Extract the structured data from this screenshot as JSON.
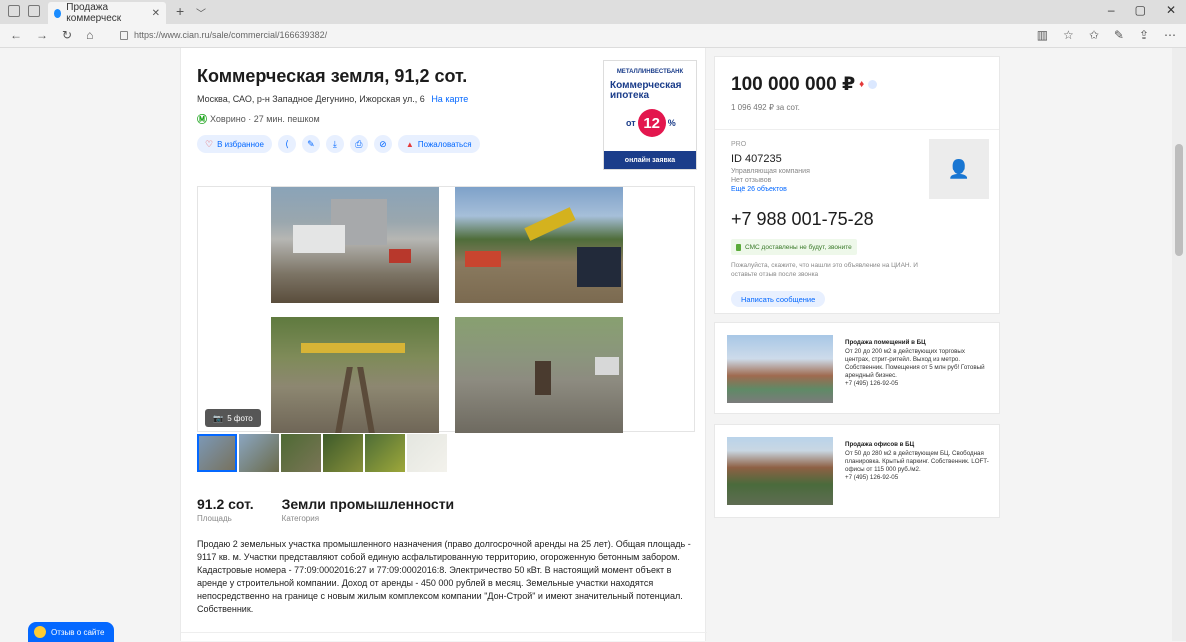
{
  "browser": {
    "tab_title": "Продажа коммерческ",
    "url": "https://www.cian.ru/sale/commercial/166639382/",
    "window_buttons": [
      "–",
      "▢",
      "✕"
    ]
  },
  "listing": {
    "title": "Коммерческая земля, 91,2 сот.",
    "address": "Москва, САО, р-н Западное Дегунино, Ижорская ул., 6",
    "map_link": "На карте",
    "metro": "Ховрино · 27 мин. пешком",
    "favorite_label": "В избранное",
    "complain_label": "Пожаловаться",
    "photo_count": "5 фото",
    "area_value": "91.2 сот.",
    "area_label": "Площадь",
    "category_value": "Земли промышленности",
    "category_label": "Категория",
    "description": "Продаю 2 земельных участка промышленного назначения (право долгосрочной аренды на 25 лет). Общая площадь - 9117 кв. м. Участки представляют собой единую асфальтированную территорию, огороженную бетонным забором. Кадастровые номера - 77:09:0002016:27 и 77:09:0002016:8. Электричество 50 кВт. В настоящий момент объект в аренде у строительной компании. Доход от аренды - 450 000 рублей в месяц. Земельные участки находятся непосредственно на границе с новым жилым комплексом компании \"Дон-Строй\" и имеют значительный потенциал. Собственник."
  },
  "banner": {
    "brand": "МЕТАЛЛИНВЕСТБАНК",
    "headline": "Коммерческая ипотека",
    "from": "от",
    "rate": "12",
    "percent": "%",
    "footer": "онлайн заявка"
  },
  "offer": {
    "price": "100 000 000 ₽",
    "price_per_unit": "1 096 492 ₽ за сот.",
    "pro_label": "PRO",
    "agent_id": "ID 407235",
    "agent_type": "Управляющая компания",
    "reviews": "Нет отзывов",
    "more_objects": "Ещё 26 объектов",
    "phone": "+7 988 001-75-28",
    "sms_note": "СМС доставлены не будут, звоните",
    "hint": "Пожалуйста, скажите, что нашли это объявление на ЦИАН. И оставьте отзыв после звонка",
    "message_button": "Написать сообщение"
  },
  "ads": [
    {
      "title": "Продажа помещений в БЦ",
      "text": "От 20 до 200 м2 в действующих торговых центрах, стрит-ритейл. Выход из метро. Собственник. Помещения от 5 млн руб! Готовый арендный бизнес.",
      "phone": "+7 (495) 126-92-05"
    },
    {
      "title": "Продажа офисов в БЦ",
      "text": "От 50 до 280 м2 в действующем БЦ. Свободная планировка. Крытый паркинг. Собственник. LOFT-офисы от 115 000 руб./м2.",
      "phone": "+7 (495) 126-92-05"
    }
  ],
  "feedback_label": "Отзыв о сайте",
  "colors": {
    "accent": "#0468ff",
    "alert": "#e43a3a",
    "banner_navy": "#1b3d8a",
    "banner_pink": "#e3174e"
  }
}
